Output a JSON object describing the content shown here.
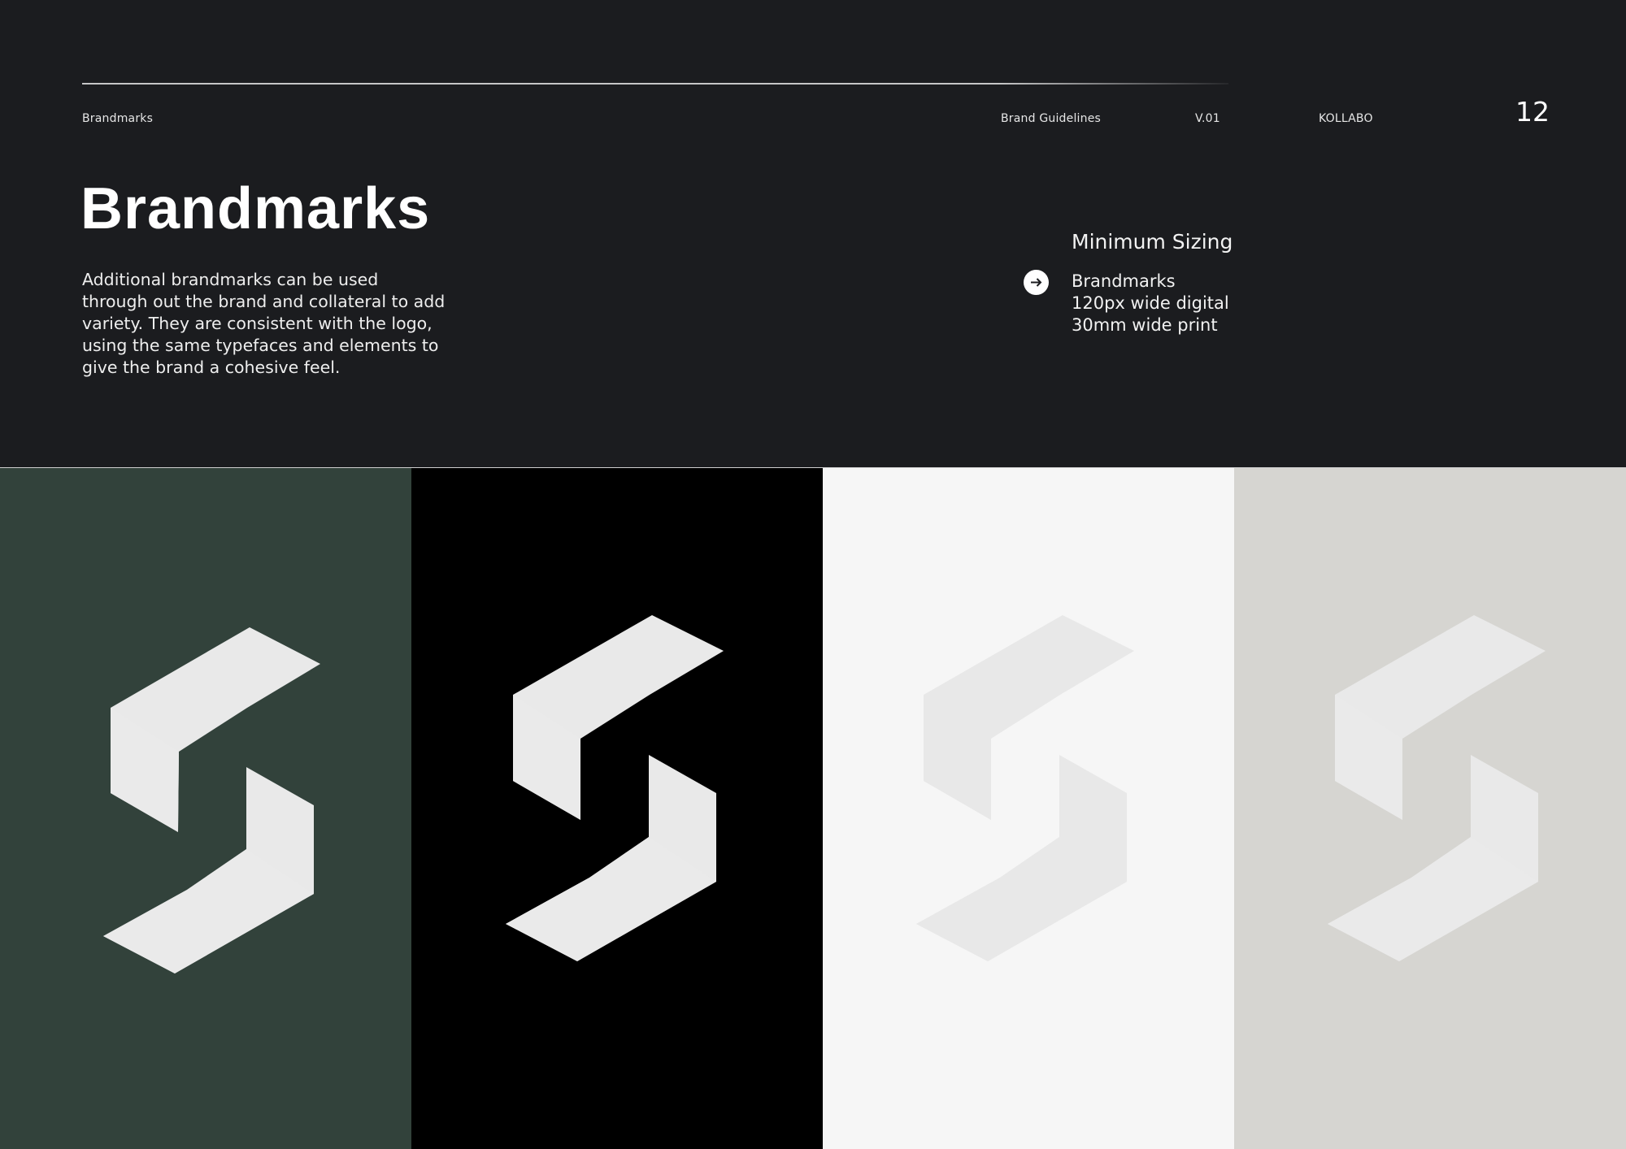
{
  "header": {
    "section": "Brandmarks",
    "doc_title": "Brand Guidelines",
    "version": "V.01",
    "brand": "KOLLABO",
    "page_number": "12"
  },
  "main": {
    "title": "Brandmarks",
    "description": "Additional brandmarks can be used through out the brand and collateral to add variety. They are consistent with the logo, using the same typefaces and elements to give the brand a cohesive feel."
  },
  "sizing": {
    "title": "Minimum Sizing",
    "icon": "arrow-right-circle-icon",
    "lines": [
      "Brandmarks",
      "120px wide digital",
      "30mm wide print"
    ]
  },
  "panels": [
    {
      "background": "#32423b",
      "mark_color": "#e9e9e9",
      "icon": "brandmark-s-icon"
    },
    {
      "background": "#000000",
      "mark_color": "#e9e9e9",
      "icon": "brandmark-s-icon"
    },
    {
      "background": "#f6f6f6",
      "mark_color": "#e8e8e8",
      "icon": "brandmark-s-icon"
    },
    {
      "background": "#d6d5d1",
      "mark_color": "#e9e9e9",
      "icon": "brandmark-s-icon"
    }
  ]
}
